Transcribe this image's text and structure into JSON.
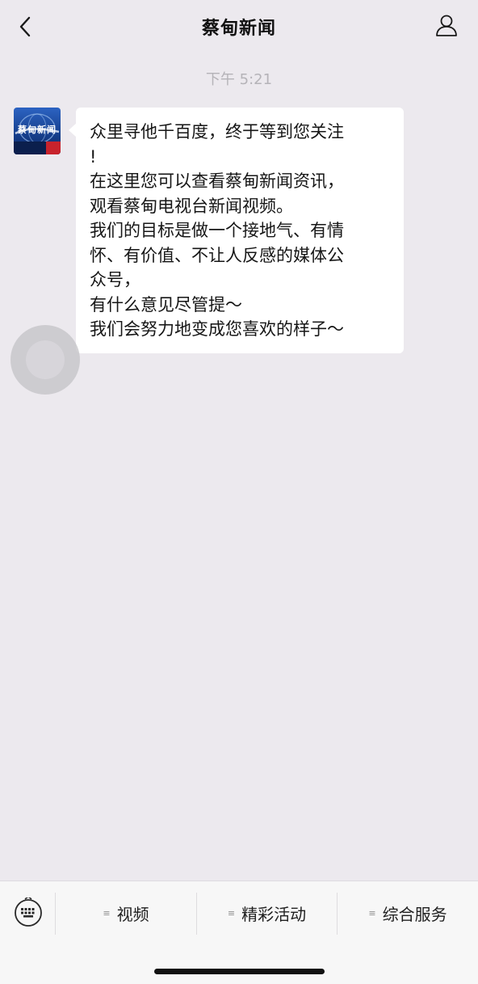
{
  "nav": {
    "title": "蔡甸新闻",
    "back_icon": "chevron-left-icon",
    "profile_icon": "person-icon"
  },
  "chat": {
    "timestamp": "下午 5:21",
    "avatar_text": "蔡甸新闻",
    "message": "众里寻他千百度，终于等到您关注\n!\n在这里您可以查看蔡甸新闻资讯，\n观看蔡甸电视台新闻视频。\n我们的目标是做一个接地气、有情\n怀、有价值、不让人反感的媒体公\n众号，\n有什么意见尽管提～\n我们会努力地变成您喜欢的样子～"
  },
  "menu": {
    "keyboard_icon": "keyboard-icon",
    "items": [
      {
        "label": "视频",
        "icon": "menu-lines-icon"
      },
      {
        "label": "精彩活动",
        "icon": "menu-lines-icon"
      },
      {
        "label": "综合服务",
        "icon": "menu-lines-icon"
      }
    ]
  },
  "colors": {
    "background": "#ece9ee",
    "bubble": "#ffffff",
    "menu_bar": "#f7f7f7",
    "timestamp": "#b5b3b8",
    "avatar_blue": "#1c4fa3",
    "avatar_red": "#c8232c"
  }
}
